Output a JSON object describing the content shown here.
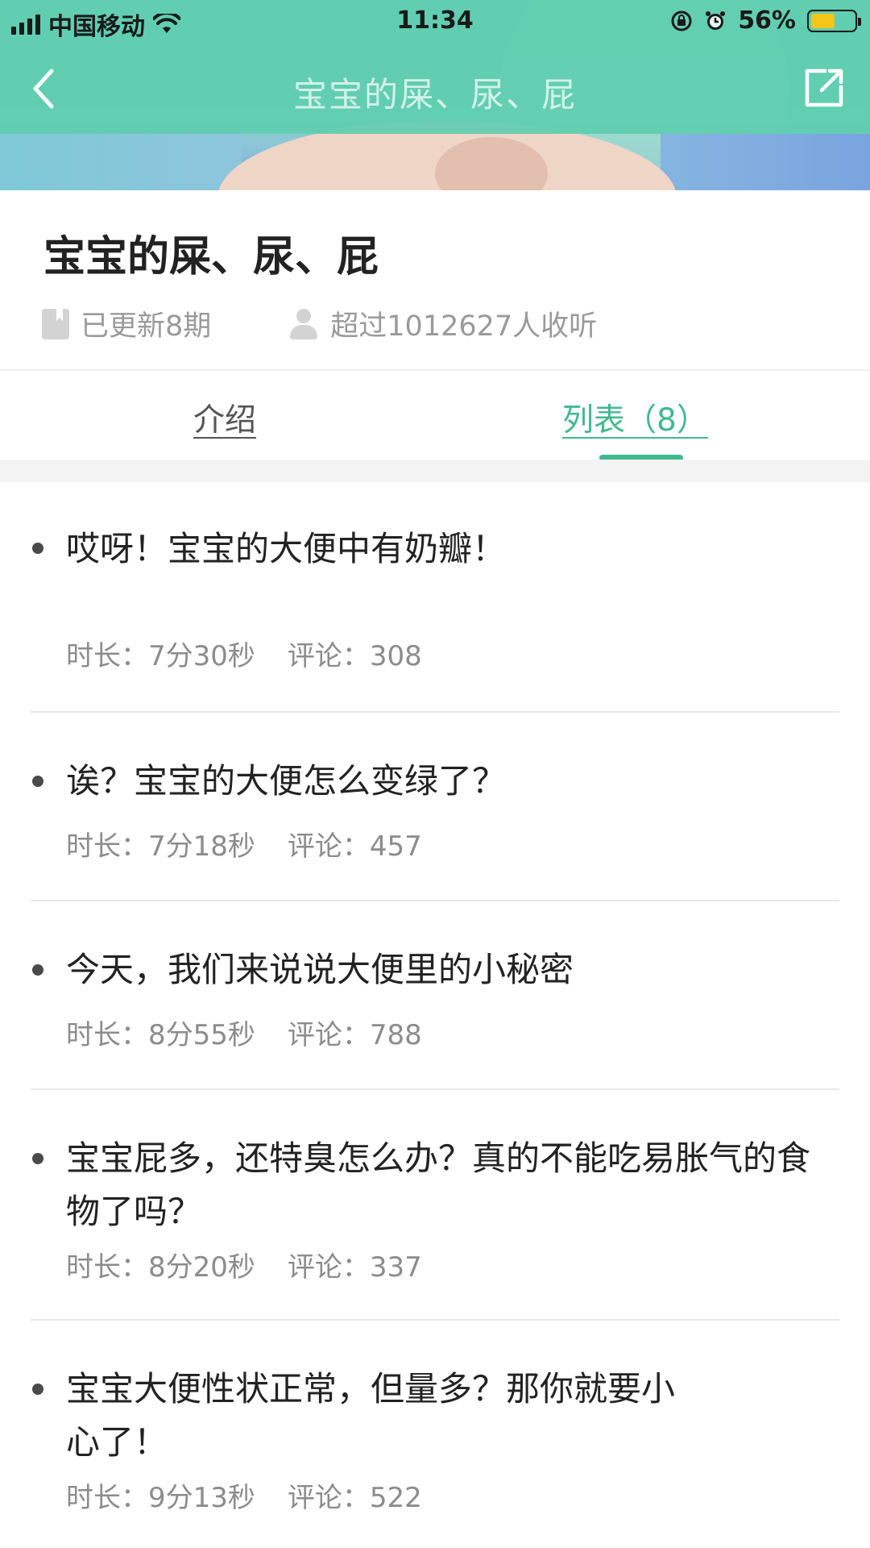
{
  "status_bar": {
    "carrier": "中国移动",
    "time": "11:34",
    "battery_percent": "56%",
    "battery_level": 0.56,
    "battery_color": "#f5c518"
  },
  "nav": {
    "title": "宝宝的屎、尿、屁",
    "back_icon": "chevron-left-icon",
    "share_icon": "share-icon"
  },
  "info": {
    "title": "宝宝的屎、尿、屁",
    "updates": "已更新8期",
    "listeners": "超过1012627人收听"
  },
  "tabs": [
    {
      "label": "介绍",
      "active": false
    },
    {
      "label": "列表（8）",
      "active": true
    }
  ],
  "accent_color": "#40b98e",
  "episodes": [
    {
      "title": "哎呀！宝宝的大便中有奶瓣！",
      "duration": "时长：7分30秒",
      "comments": "评论：308"
    },
    {
      "title": "诶？宝宝的大便怎么变绿了？",
      "duration": "时长：7分18秒",
      "comments": "评论：457"
    },
    {
      "title": "今天，我们来说说大便里的小秘密",
      "duration": "时长：8分55秒",
      "comments": "评论：788"
    },
    {
      "title": "宝宝屁多，还特臭怎么办？真的不能吃易胀气的食物了吗？",
      "duration": "时长：8分20秒",
      "comments": "评论：337"
    },
    {
      "title": "宝宝大便性状正常，但量多？那你就要小心了！",
      "duration": "时长：9分13秒",
      "comments": "评论：522"
    }
  ]
}
